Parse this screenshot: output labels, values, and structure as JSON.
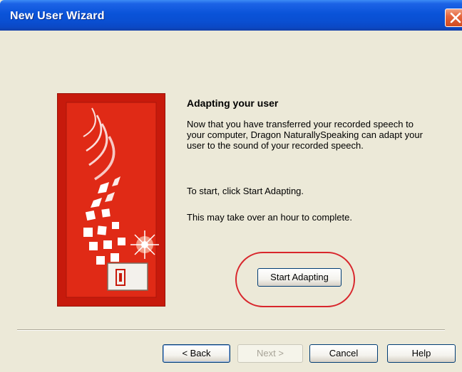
{
  "window": {
    "title": "New User Wizard"
  },
  "content": {
    "heading": "Adapting your user",
    "paragraph1": "Now that you have transferred your recorded speech to your computer, Dragon NaturallySpeaking can adapt your user to the sound of your recorded speech.",
    "paragraph2": "To start, click Start Adapting.",
    "paragraph3": "This may take over an hour to complete."
  },
  "buttons": {
    "start_adapting": "Start Adapting",
    "back": "< Back",
    "next": "Next >",
    "cancel": "Cancel",
    "help": "Help"
  },
  "icons": {
    "close": "close-icon",
    "illustration": "dragon-wizard-graphic"
  },
  "colors": {
    "titlebar": "#0a53d8",
    "panel_bg": "#ece9d8",
    "graphic_red": "#c71a0c",
    "highlight_circle": "#d8262c"
  }
}
